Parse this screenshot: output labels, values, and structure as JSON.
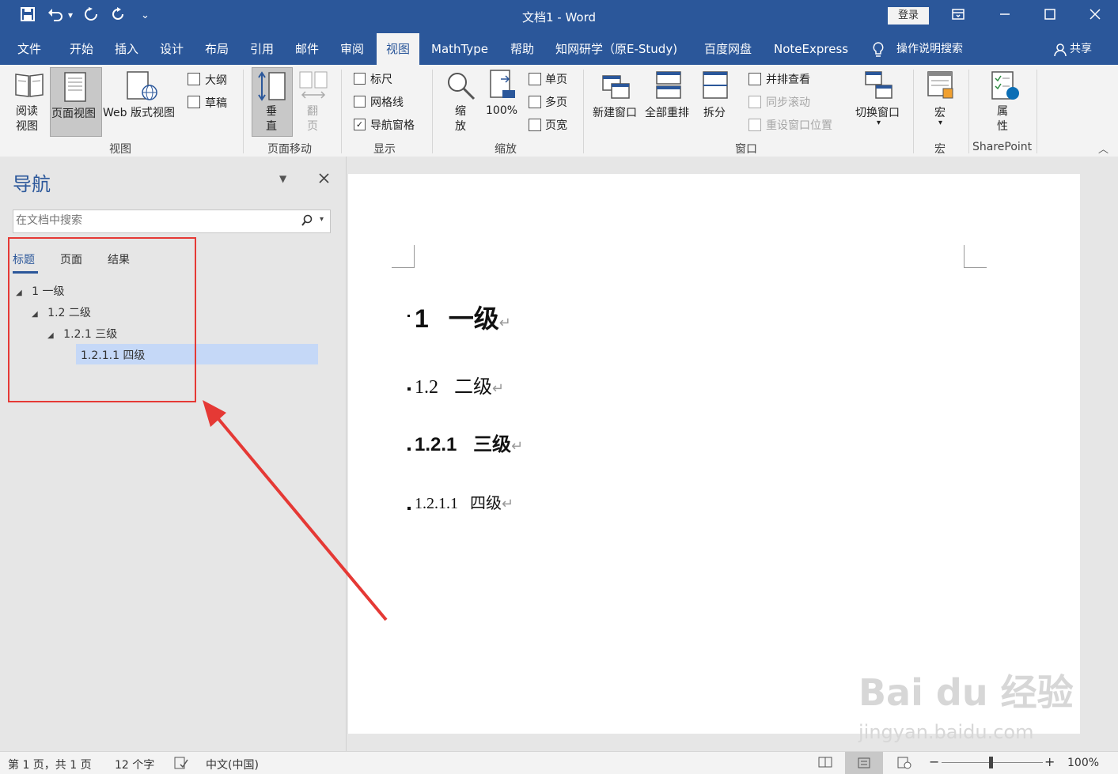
{
  "window": {
    "title": "文档1  -  Word",
    "login_label": "登录",
    "minimize_icon": "minimize-icon",
    "restore_icon": "ribbon-display-icon",
    "close_icon": "close-icon"
  },
  "quick_access": {
    "more_symbol": "⌄"
  },
  "tabs": [
    "文件",
    "开始",
    "插入",
    "设计",
    "布局",
    "引用",
    "邮件",
    "审阅",
    "视图",
    "MathType",
    "帮助",
    "知网研学（原E-Study)",
    "百度网盘",
    "NoteExpress",
    "操作说明搜索"
  ],
  "share_label": "共享",
  "ribbon": {
    "view": {
      "read_label": "阅读\n视图",
      "print_label": "页面视图",
      "web_label": "Web 版式视图",
      "outline_label": "大纲",
      "draft_label": "草稿",
      "group": "视图"
    },
    "page_move": {
      "vertical_label": "垂\n直",
      "flip_label": "翻\n页",
      "group": "页面移动"
    },
    "show": {
      "ruler": "标尺",
      "gridlines": "网格线",
      "nav_pane": "导航窗格",
      "group": "显示",
      "nav_checked_mark": "✓"
    },
    "zoom": {
      "zoom_label": "缩\n放",
      "hundred_label": "100%",
      "one_page": "单页",
      "multi_page": "多页",
      "page_width": "页宽",
      "group": "缩放"
    },
    "window": {
      "new_window": "新建窗口",
      "arrange_all": "全部重排",
      "split": "拆分",
      "side_by_side": "并排查看",
      "sync_scroll": "同步滚动",
      "reset_pos": "重设窗口位置",
      "switch_windows": "切换窗口",
      "group": "窗口"
    },
    "macros": {
      "label": "宏",
      "group": "宏"
    },
    "sharepoint": {
      "label": "属\n性",
      "group": "SharePoint"
    }
  },
  "nav": {
    "title": "导航",
    "search_placeholder": "在文档中搜索",
    "tabs": [
      "标题",
      "页面",
      "结果"
    ],
    "tree": [
      "1 一级",
      "1.2 二级",
      "1.2.1 三级",
      "1.2.1.1 四级"
    ],
    "tree_marker": "◢"
  },
  "document": {
    "headings": [
      {
        "num": "1",
        "text": "一级"
      },
      {
        "num": "1.2",
        "text": "二级"
      },
      {
        "num": "1.2.1",
        "text": "三级"
      },
      {
        "num": "1.2.1.1",
        "text": "四级"
      }
    ],
    "para_mark": "↵"
  },
  "status": {
    "page": "第 1 页，共 1 页",
    "words": "12 个字",
    "language": "中文(中国)",
    "zoom": "100%",
    "zoom_minus": "−",
    "zoom_plus": "+"
  },
  "watermark": {
    "text": "Bai du 经验",
    "url": "jingyan.baidu.com"
  },
  "colors": {
    "accent": "#2b579a",
    "highlight": "#c5d8f7",
    "annotation": "#e53935"
  }
}
